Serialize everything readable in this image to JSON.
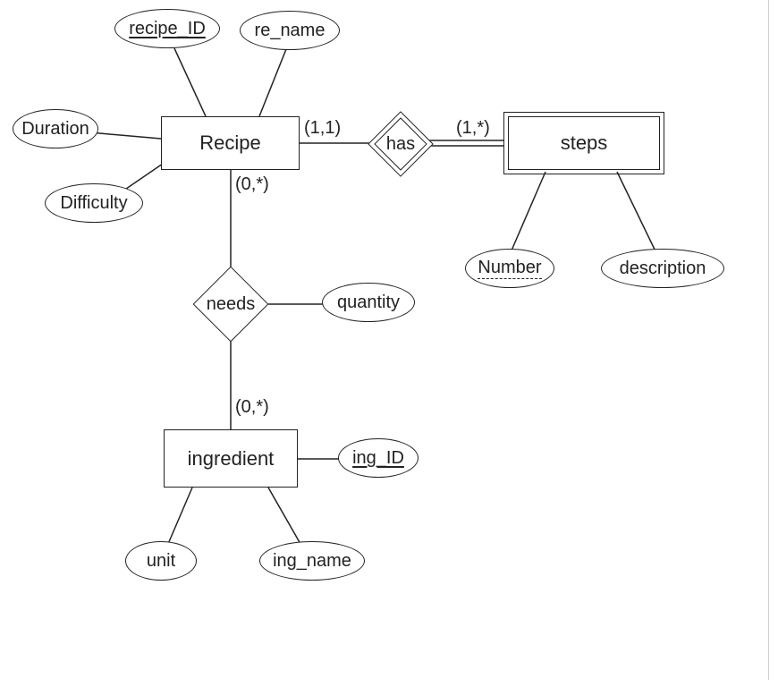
{
  "diagram_type": "Entity-Relationship Diagram (Chen notation)",
  "entities": {
    "recipe": {
      "label": "Recipe",
      "kind": "entity",
      "attributes": {
        "recipe_id": {
          "label": "recipe_ID",
          "key": "primary"
        },
        "re_name": {
          "label": "re_name",
          "key": null
        },
        "duration": {
          "label": "Duration",
          "key": null
        },
        "difficulty": {
          "label": "Difficulty",
          "key": null
        }
      }
    },
    "steps": {
      "label": "steps",
      "kind": "weak-entity",
      "attributes": {
        "number": {
          "label": "Number",
          "key": "partial"
        },
        "description": {
          "label": "description",
          "key": null
        }
      }
    },
    "ingredient": {
      "label": "ingredient",
      "kind": "entity",
      "attributes": {
        "ing_id": {
          "label": "ing_ID",
          "key": "primary"
        },
        "ing_name": {
          "label": "ing_name",
          "key": null
        },
        "unit": {
          "label": "unit",
          "key": null
        }
      }
    }
  },
  "relationships": {
    "has": {
      "label": "has",
      "kind": "identifying",
      "endpoints": {
        "recipe": {
          "cardinality": "(1,1)"
        },
        "steps": {
          "cardinality": "(1,*)"
        }
      }
    },
    "needs": {
      "label": "needs",
      "kind": "regular",
      "endpoints": {
        "recipe": {
          "cardinality": "(0,*)"
        },
        "ingredient": {
          "cardinality": "(0,*)"
        }
      },
      "attributes": {
        "quantity": {
          "label": "quantity",
          "key": null
        }
      }
    }
  }
}
